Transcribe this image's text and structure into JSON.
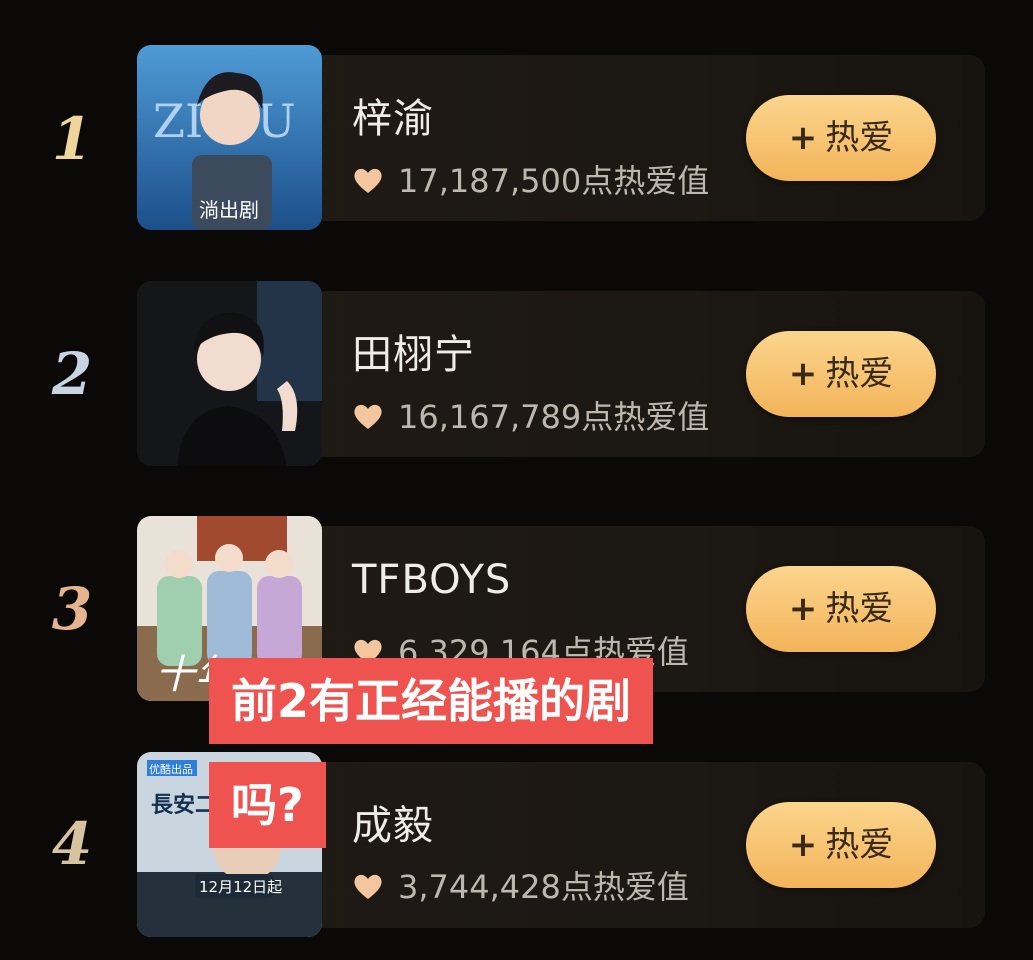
{
  "list": [
    {
      "rank": "1",
      "name": "梓渝",
      "score": "17,187,500点热爱值",
      "button": "热爱",
      "thumb_text": "淌出剧",
      "thumb_logo": "ZI·YU"
    },
    {
      "rank": "2",
      "name": "田栩宁",
      "score": "16,167,789点热爱值",
      "button": "热爱"
    },
    {
      "rank": "3",
      "name": "TFBOYS",
      "score": "6,329,164点热爱值",
      "button": "热爱",
      "thumb_text": "十年"
    },
    {
      "rank": "4",
      "name": "成毅",
      "score": "3,744,428点热爱值",
      "button": "热爱",
      "thumb_title": "長安二十四計",
      "thumb_date": "12月12日起",
      "thumb_badge": "优酷出品"
    }
  ],
  "button_plus": "+",
  "overlay": {
    "line1": "前2有正经能播的剧",
    "line2": "吗?"
  },
  "colors": {
    "background": "#0b0908",
    "card": "#1f1a15",
    "button": "#f3b45a",
    "heart": "#f4c6a0",
    "overlay": "#ef5350"
  }
}
